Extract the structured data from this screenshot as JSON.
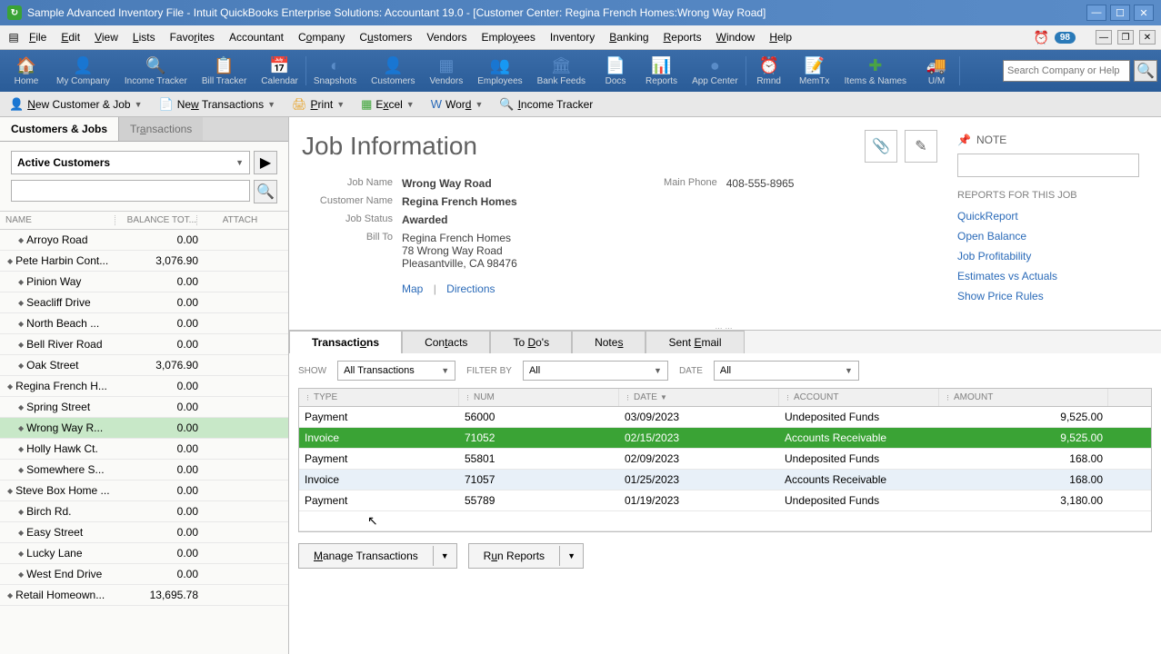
{
  "title_bar": {
    "text": "Sample Advanced Inventory File  - Intuit QuickBooks Enterprise Solutions: Accountant 19.0 - [Customer Center: Regina French Homes:Wrong Way Road]"
  },
  "menu": {
    "items": [
      "File",
      "Edit",
      "View",
      "Lists",
      "Favorites",
      "Accountant",
      "Company",
      "Customers",
      "Vendors",
      "Employees",
      "Inventory",
      "Banking",
      "Reports",
      "Window",
      "Help"
    ],
    "badge": "98"
  },
  "toolbar": {
    "items": [
      "Home",
      "My Company",
      "Income Tracker",
      "Bill Tracker",
      "Calendar",
      "Snapshots",
      "Customers",
      "Vendors",
      "Employees",
      "Bank Feeds",
      "Docs",
      "Reports",
      "App Center",
      "Rmnd",
      "MemTx",
      "Items & Names",
      "U/M"
    ],
    "search_placeholder": "Search Company or Help"
  },
  "action_bar": {
    "new_customer": "New Customer & Job",
    "new_txn": "New Transactions",
    "print": "Print",
    "excel": "Excel",
    "word": "Word",
    "income_tracker": "Income Tracker"
  },
  "left_panel": {
    "tab_customers": "Customers & Jobs",
    "tab_transactions": "Transactions",
    "filter": "Active Customers",
    "col_name": "NAME",
    "col_bal": "BALANCE TOT...",
    "col_att": "ATTACH",
    "rows": [
      {
        "name": "Arroyo Road",
        "bal": "0.00",
        "indent": 1
      },
      {
        "name": "Pete Harbin Cont...",
        "bal": "3,076.90",
        "indent": 0
      },
      {
        "name": "Pinion Way",
        "bal": "0.00",
        "indent": 1
      },
      {
        "name": "Seacliff Drive",
        "bal": "0.00",
        "indent": 1
      },
      {
        "name": "North Beach ...",
        "bal": "0.00",
        "indent": 1
      },
      {
        "name": "Bell River Road",
        "bal": "0.00",
        "indent": 1
      },
      {
        "name": "Oak Street",
        "bal": "3,076.90",
        "indent": 1
      },
      {
        "name": "Regina French H...",
        "bal": "0.00",
        "indent": 0
      },
      {
        "name": "Spring Street",
        "bal": "0.00",
        "indent": 1
      },
      {
        "name": "Wrong Way R...",
        "bal": "0.00",
        "indent": 1,
        "selected": true
      },
      {
        "name": "Holly Hawk Ct.",
        "bal": "0.00",
        "indent": 1
      },
      {
        "name": "Somewhere S...",
        "bal": "0.00",
        "indent": 1
      },
      {
        "name": "Steve Box Home ...",
        "bal": "0.00",
        "indent": 0
      },
      {
        "name": "Birch Rd.",
        "bal": "0.00",
        "indent": 1
      },
      {
        "name": "Easy Street",
        "bal": "0.00",
        "indent": 1
      },
      {
        "name": "Lucky Lane",
        "bal": "0.00",
        "indent": 1
      },
      {
        "name": "West End Drive",
        "bal": "0.00",
        "indent": 1
      },
      {
        "name": "Retail Homeown...",
        "bal": "13,695.78",
        "indent": 0
      }
    ]
  },
  "job_info": {
    "title": "Job Information",
    "labels": {
      "job_name": "Job Name",
      "customer_name": "Customer Name",
      "job_status": "Job Status",
      "bill_to": "Bill To",
      "main_phone": "Main Phone"
    },
    "job_name": "Wrong Way Road",
    "customer_name": "Regina French Homes",
    "job_status": "Awarded",
    "bill_to_1": "Regina French Homes",
    "bill_to_2": "78 Wrong Way Road",
    "bill_to_3": "Pleasantville, CA 98476",
    "main_phone": "408-555-8965",
    "map": "Map",
    "directions": "Directions"
  },
  "side": {
    "note": "NOTE",
    "reports_title": "REPORTS FOR THIS JOB",
    "links": [
      "QuickReport",
      "Open Balance",
      "Job Profitability",
      "Estimates vs Actuals",
      "Show Price Rules"
    ]
  },
  "bottom": {
    "tabs": {
      "transactions": "Transactions",
      "contacts": "Contacts",
      "todos": "To Do's",
      "notes": "Notes",
      "sent_email": "Sent Email"
    },
    "show_label": "SHOW",
    "show_value": "All Transactions",
    "filterby_label": "FILTER BY",
    "filterby_value": "All",
    "date_label": "DATE",
    "date_value": "All",
    "cols": {
      "type": "TYPE",
      "num": "NUM",
      "date": "DATE",
      "account": "ACCOUNT",
      "amount": "AMOUNT"
    },
    "rows": [
      {
        "type": "Payment",
        "num": "56000",
        "date": "03/09/2023",
        "acct": "Undeposited Funds",
        "amt": "9,525.00"
      },
      {
        "type": "Invoice",
        "num": "71052",
        "date": "02/15/2023",
        "acct": "Accounts Receivable",
        "amt": "9,525.00",
        "selected": true
      },
      {
        "type": "Payment",
        "num": "55801",
        "date": "02/09/2023",
        "acct": "Undeposited Funds",
        "amt": "168.00"
      },
      {
        "type": "Invoice",
        "num": "71057",
        "date": "01/25/2023",
        "acct": "Accounts Receivable",
        "amt": "168.00",
        "alt": true
      },
      {
        "type": "Payment",
        "num": "55789",
        "date": "01/19/2023",
        "acct": "Undeposited Funds",
        "amt": "3,180.00"
      }
    ],
    "manage_btn": "Manage Transactions",
    "run_btn": "Run Reports"
  }
}
